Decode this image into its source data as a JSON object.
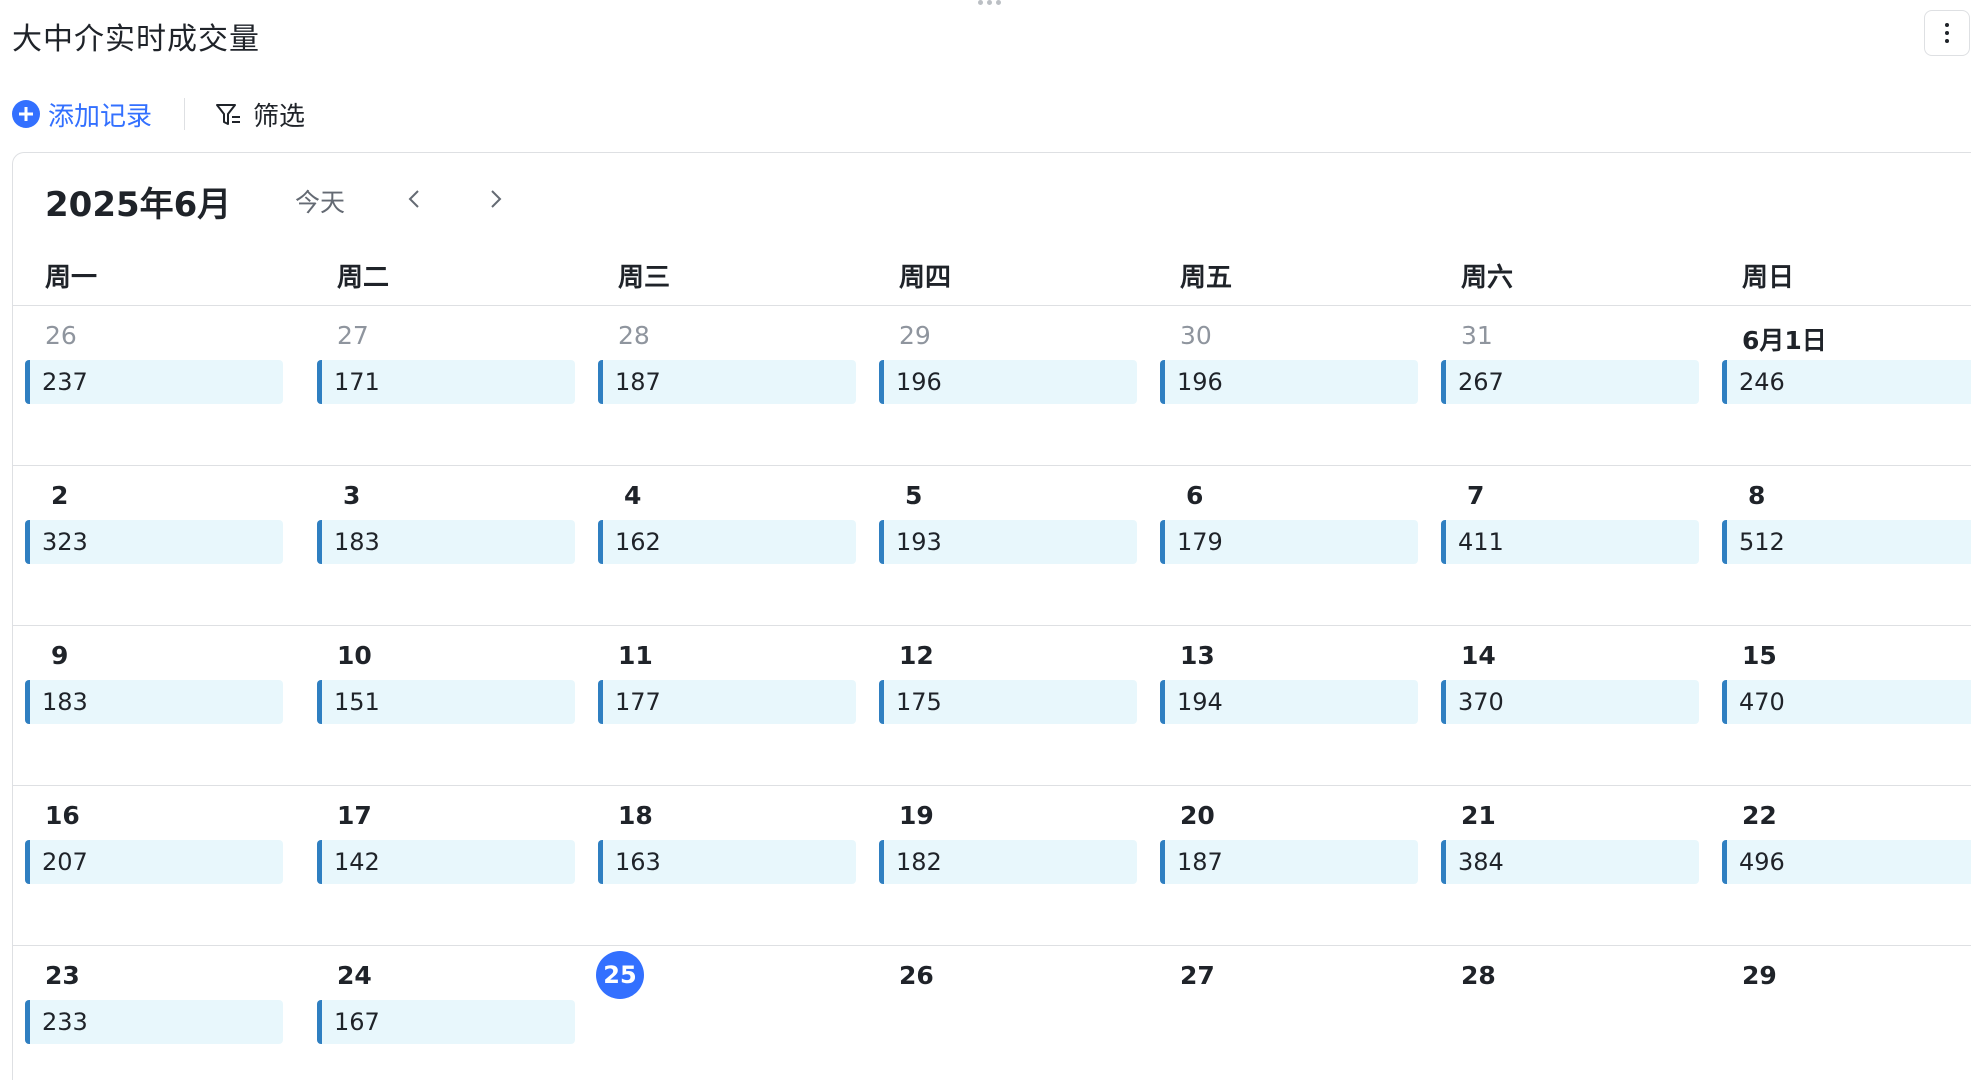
{
  "header": {
    "title": "大中介实时成交量"
  },
  "toolbar": {
    "add_label": "添加记录",
    "filter_label": "筛选"
  },
  "calendar": {
    "month_label": "2025年6月",
    "today_label": "今天",
    "weekdays": [
      "周一",
      "周二",
      "周三",
      "周四",
      "周五",
      "周六",
      "周日"
    ],
    "weeks": [
      [
        {
          "day": "26",
          "muted": true,
          "value": "237"
        },
        {
          "day": "27",
          "muted": true,
          "value": "171"
        },
        {
          "day": "28",
          "muted": true,
          "value": "187"
        },
        {
          "day": "29",
          "muted": true,
          "value": "196"
        },
        {
          "day": "30",
          "muted": true,
          "value": "196"
        },
        {
          "day": "31",
          "muted": true,
          "value": "267"
        },
        {
          "day": "6月1日",
          "muted": false,
          "value": "246"
        }
      ],
      [
        {
          "day": "2",
          "value": "323"
        },
        {
          "day": "3",
          "value": "183"
        },
        {
          "day": "4",
          "value": "162"
        },
        {
          "day": "5",
          "value": "193"
        },
        {
          "day": "6",
          "value": "179"
        },
        {
          "day": "7",
          "value": "411"
        },
        {
          "day": "8",
          "value": "512"
        }
      ],
      [
        {
          "day": "9",
          "value": "183"
        },
        {
          "day": "10",
          "value": "151"
        },
        {
          "day": "11",
          "value": "177"
        },
        {
          "day": "12",
          "value": "175"
        },
        {
          "day": "13",
          "value": "194"
        },
        {
          "day": "14",
          "value": "370"
        },
        {
          "day": "15",
          "value": "470"
        }
      ],
      [
        {
          "day": "16",
          "value": "207"
        },
        {
          "day": "17",
          "value": "142"
        },
        {
          "day": "18",
          "value": "163"
        },
        {
          "day": "19",
          "value": "182"
        },
        {
          "day": "20",
          "value": "187"
        },
        {
          "day": "21",
          "value": "384"
        },
        {
          "day": "22",
          "value": "496"
        }
      ],
      [
        {
          "day": "23",
          "value": "233"
        },
        {
          "day": "24",
          "value": "167"
        },
        {
          "day": "25",
          "today": true
        },
        {
          "day": "26"
        },
        {
          "day": "27"
        },
        {
          "day": "28"
        },
        {
          "day": "29"
        }
      ]
    ]
  },
  "colors": {
    "accent": "#3370ff",
    "event_bg": "#e8f7fc",
    "event_bar": "#2f7fc1"
  }
}
